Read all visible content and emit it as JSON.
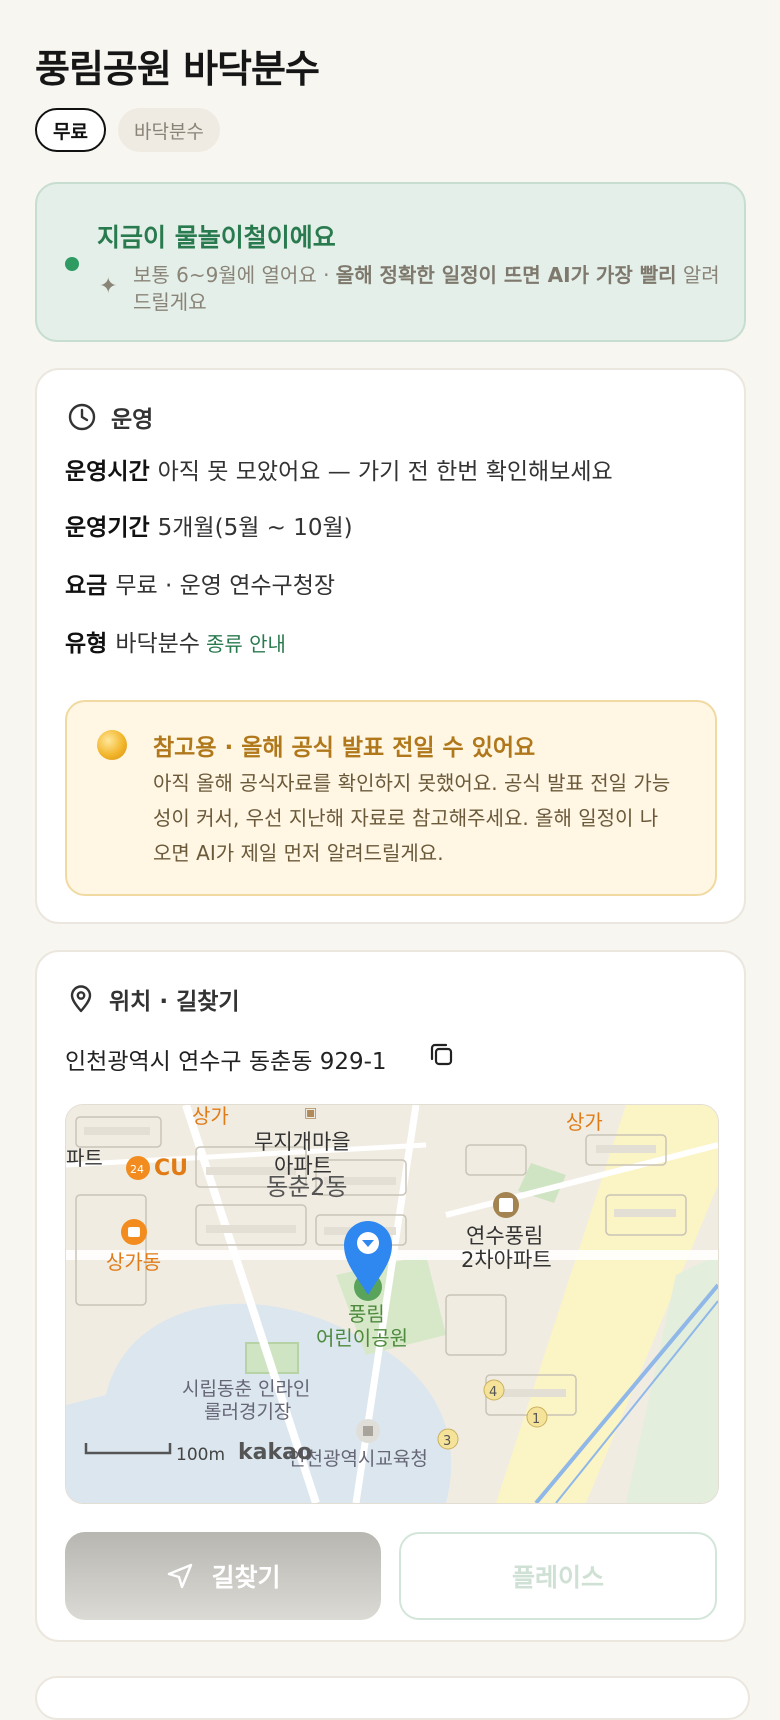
{
  "title": "풍림공원 바닥분수",
  "chips": [
    {
      "label": "무료",
      "active": true
    },
    {
      "label": "바닥분수",
      "active": false
    }
  ],
  "season": {
    "headline": "지금이 물놀이철이에요",
    "sub_plain": "보통 6~9월에 열어요 · ",
    "sub_bold": "올해 정확한 일정이 뜨면 AI가 가장 빨리",
    "sub_tail": "알려드릴게요"
  },
  "operation": {
    "heading": "운영",
    "rows": [
      {
        "label": "운영시간",
        "value": "아직 못 모았어요 — 가기 전 한번 확인해보세요"
      },
      {
        "label": "운영기간",
        "value": "5개월(5월 ~ 10월)"
      },
      {
        "label": "요금",
        "value": "무료 · 운영 연수구청장"
      },
      {
        "label": "유형",
        "value": "바닥분수",
        "link": "종류 안내"
      }
    ],
    "notice": {
      "title": "참고용 · 올해 공식 발표 전일 수 있어요",
      "body": "아직 올해 공식자료를 확인하지 못했어요. 공식 발표 전일 가능성이 커서, 우선 지난해 자료로 참고해주세요. 올해 일정이 나오면 AI가 제일 먼저 알려드릴게요."
    }
  },
  "location": {
    "heading": "위치 · 길찾기",
    "address": "인천광역시 연수구 동춘동 929-1",
    "map": {
      "labels": {
        "sangga_tl": "상가",
        "sangga_tr": "상가",
        "rainbow_1": "무지개마을",
        "rainbow_2": "아파트",
        "dong": "동춘2동",
        "apt_left": "파트",
        "cu": "CU",
        "sanggadong": "상가동",
        "yeonsu_1": "연수풍림",
        "yeonsu_2": "2차아파트",
        "park_1": "풍림",
        "park_2": "어린이공원",
        "rink_1": "시립동춘 인라인",
        "rink_2": "롤러경기장",
        "office": "인천광역시교육청",
        "scale": "100m",
        "brand": "kakao",
        "marker_4": "4",
        "marker_1": "1",
        "marker_3": "3",
        "cu_badge": "24"
      }
    },
    "directions_label": "길찾기",
    "place_label": "플레이스"
  },
  "colors": {
    "accent_green": "#2a7a4f",
    "season_bg": "#e3efe8",
    "notice_bg": "#fff6e4",
    "notice_title": "#b0781b",
    "pin_blue": "#2f87f0"
  }
}
